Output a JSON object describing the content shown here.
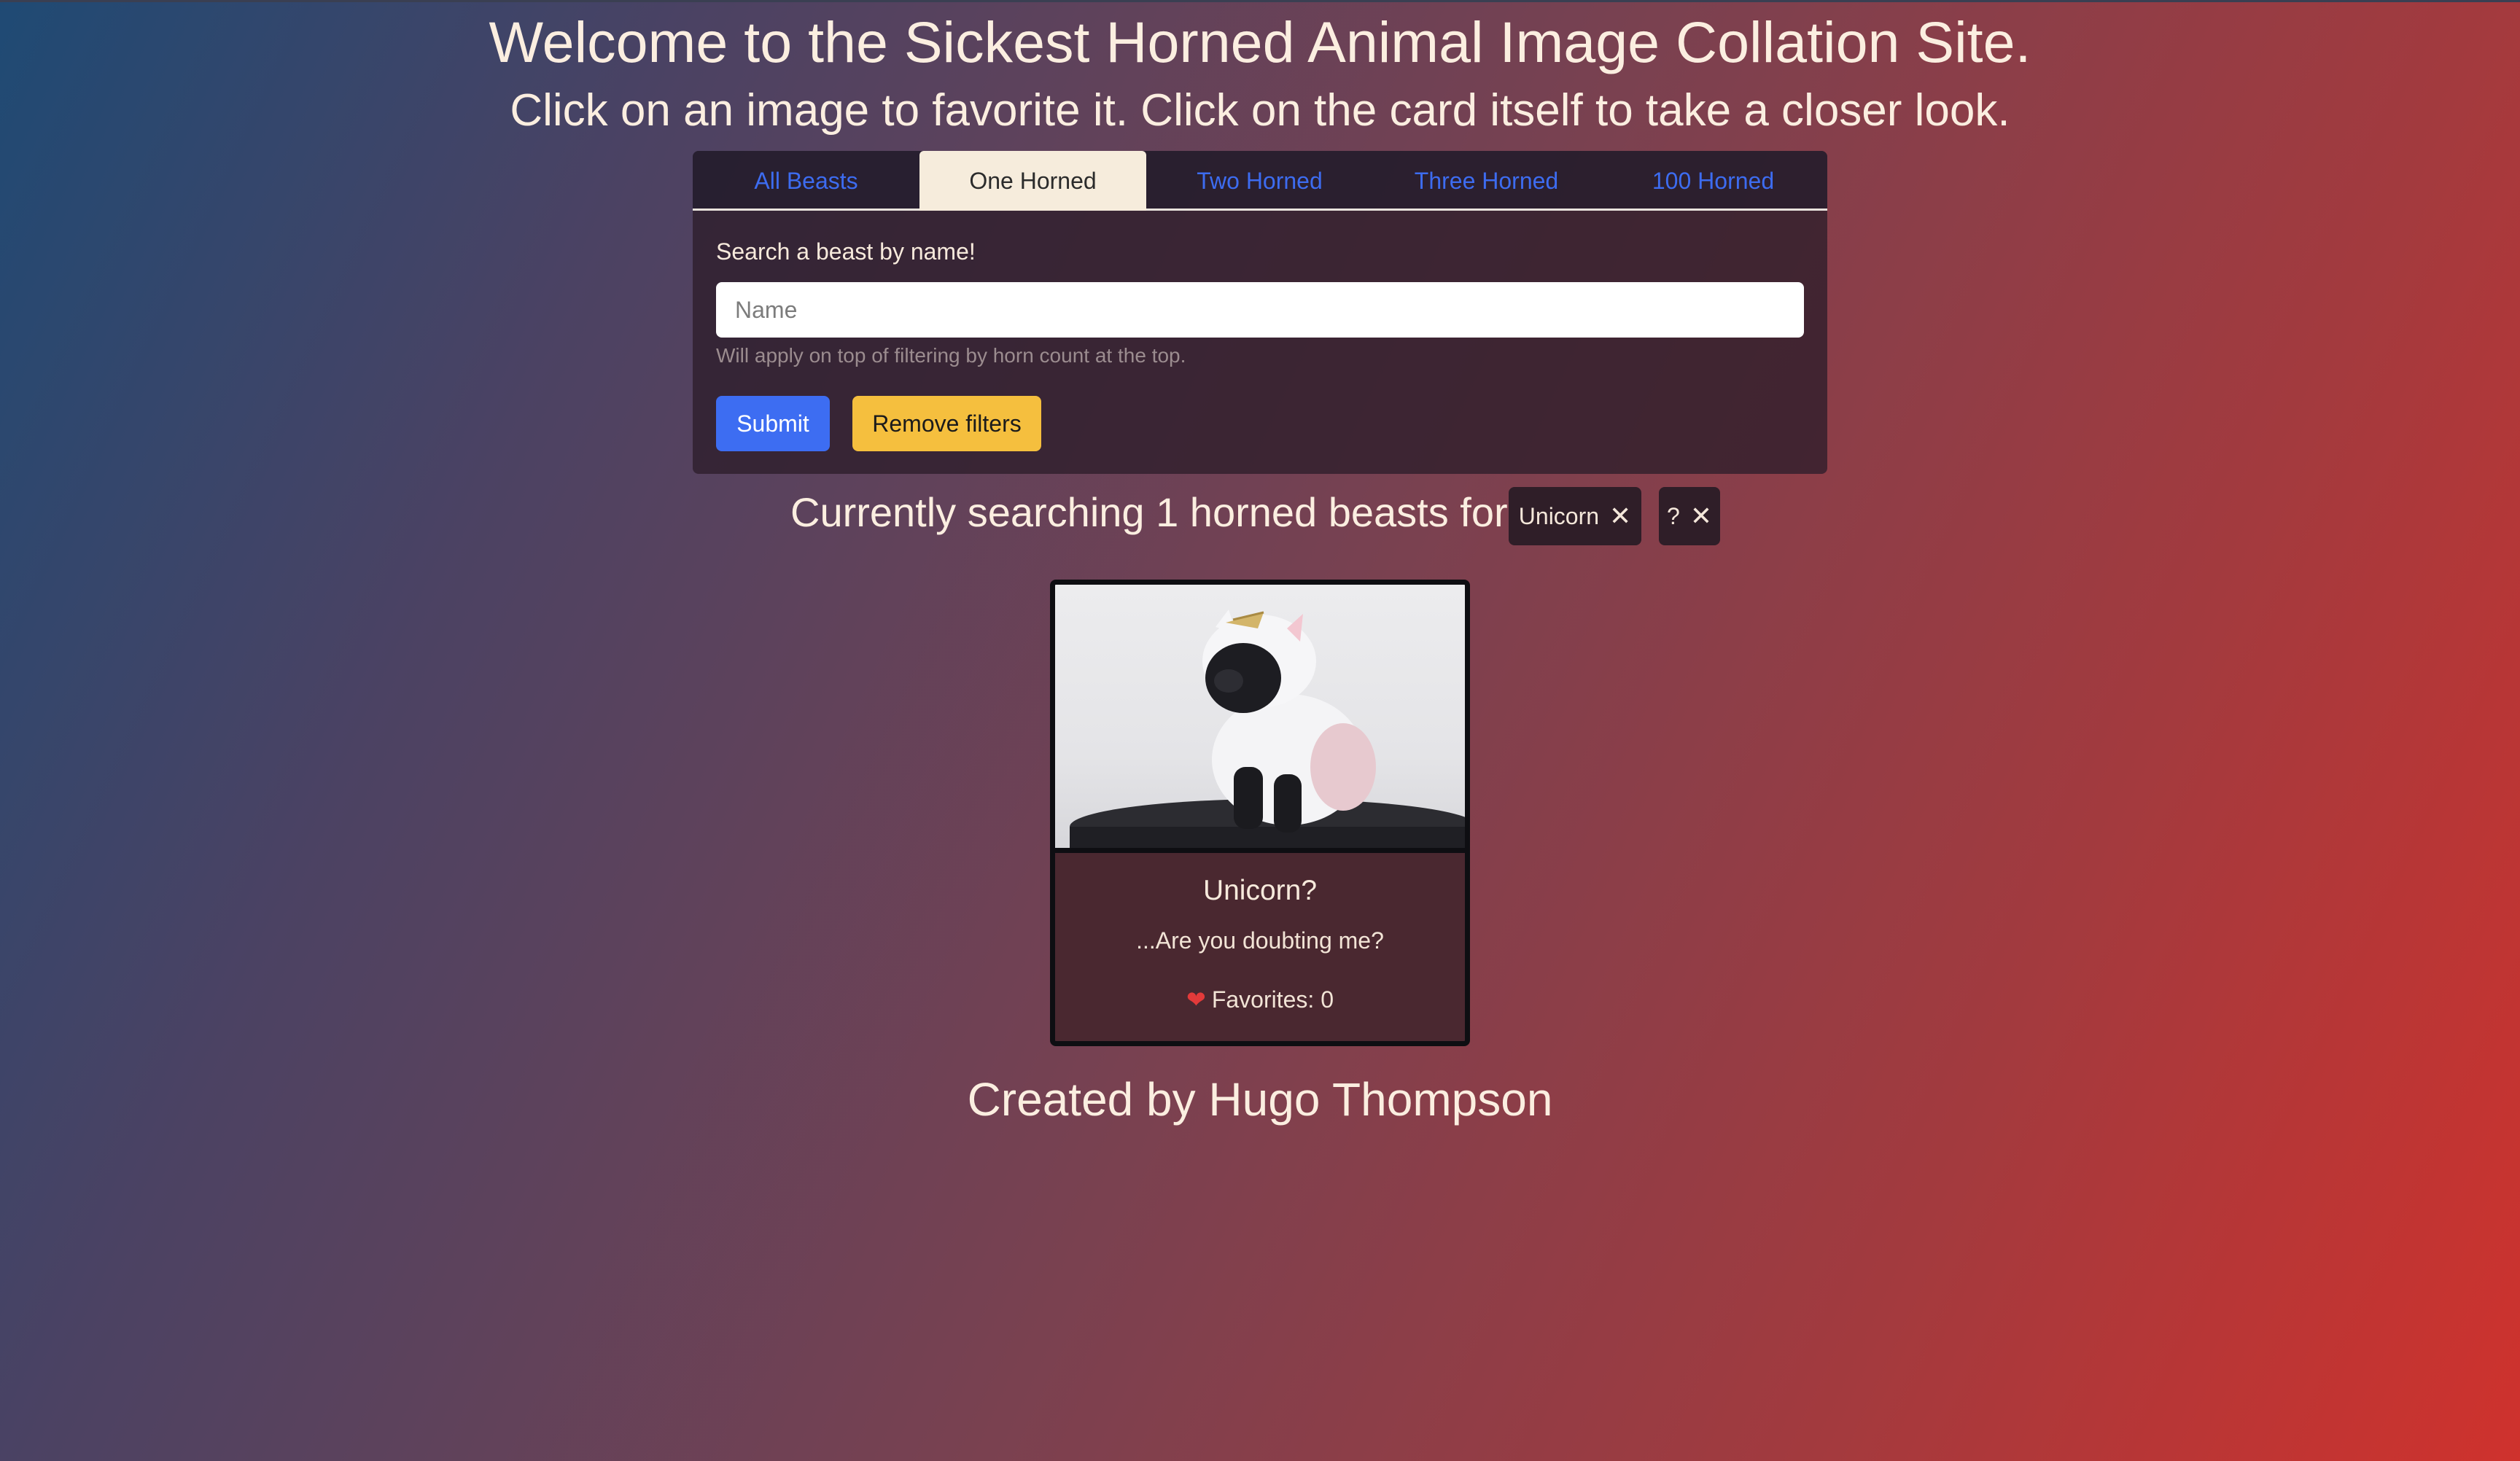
{
  "header": {
    "title": "Welcome to the Sickest Horned Animal Image Collation Site.",
    "subtitle": "Click on an image to favorite it. Click on the card itself to take a closer look."
  },
  "tabs": [
    {
      "label": "All Beasts",
      "active": false
    },
    {
      "label": "One Horned",
      "active": true
    },
    {
      "label": "Two Horned",
      "active": false
    },
    {
      "label": "Three Horned",
      "active": false
    },
    {
      "label": "100 Horned",
      "active": false
    }
  ],
  "search": {
    "label": "Search a beast by name!",
    "placeholder": "Name",
    "value": "",
    "hint": "Will apply on top of filtering by horn count at the top."
  },
  "buttons": {
    "submit": "Submit",
    "remove_filters": "Remove filters"
  },
  "status": {
    "text": "Currently searching 1 horned beasts for",
    "chips": [
      {
        "label": "Unicorn",
        "close": "✕"
      },
      {
        "label": "?",
        "close": "✕"
      }
    ]
  },
  "card": {
    "title": "Unicorn?",
    "description": "...Are you doubting me?",
    "favorites_label": "Favorites: 0",
    "heart_icon": "heart-icon"
  },
  "footer": {
    "text": "Created by Hugo Thompson"
  },
  "colors": {
    "primary": "#3d6df2",
    "warning": "#f5bf3e",
    "tab_active_bg": "#f6ecdc",
    "tab_link": "#3d6cf0"
  }
}
